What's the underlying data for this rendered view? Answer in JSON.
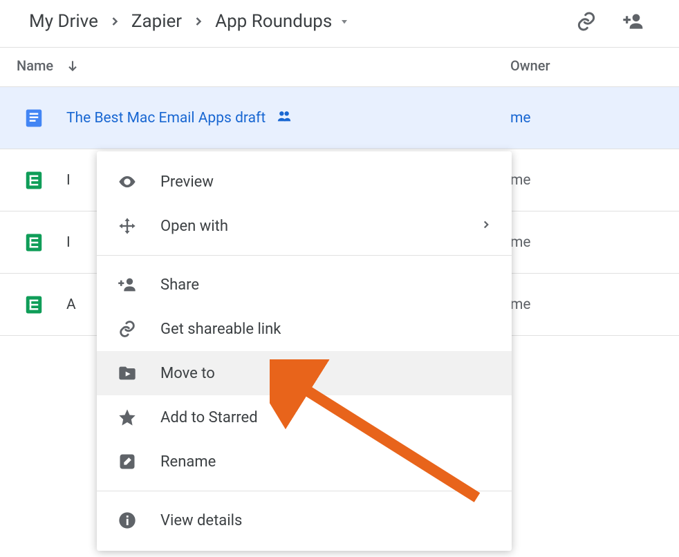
{
  "breadcrumb": {
    "items": [
      "My Drive",
      "Zapier",
      "App Roundups"
    ]
  },
  "columns": {
    "name": "Name",
    "owner": "Owner"
  },
  "files": [
    {
      "name": "The Best Mac Email Apps draft",
      "type": "doc",
      "owner": "me",
      "shared": true,
      "selected": true
    },
    {
      "name": "I",
      "type": "sheet",
      "owner": "me",
      "shared": false,
      "selected": false
    },
    {
      "name": "I",
      "type": "sheet",
      "owner": "me",
      "shared": false,
      "selected": false
    },
    {
      "name": "A",
      "type": "sheet",
      "owner": "me",
      "shared": false,
      "selected": false
    }
  ],
  "menu": {
    "preview": "Preview",
    "open_with": "Open with",
    "share": "Share",
    "get_link": "Get shareable link",
    "move_to": "Move to",
    "add_star": "Add to Starred",
    "rename": "Rename",
    "view_details": "View details"
  },
  "colors": {
    "doc_blue": "#4285f4",
    "sheet_green": "#0f9d58",
    "highlight_orange": "#e8641b"
  }
}
